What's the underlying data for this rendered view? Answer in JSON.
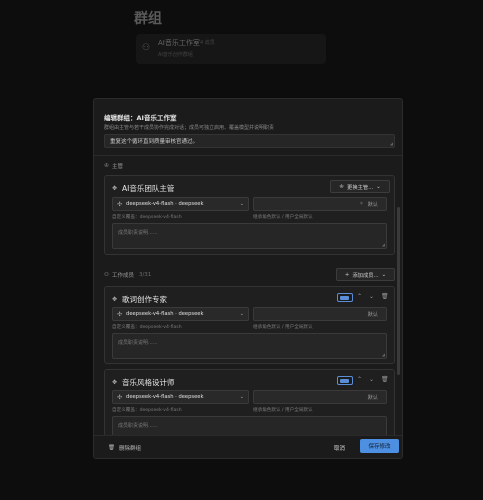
{
  "background": {
    "title": "群组",
    "group_card": {
      "name": "AI音乐工作室",
      "count": "4 成员",
      "desc": "AI音乐创作群组"
    }
  },
  "modal": {
    "title": "编辑群组：AI音乐工作室",
    "desc": "群组由主管与若干成员协作完成对话；成员可独立启用、覆盖模型并说明职责",
    "top_textarea_value": "重复这个循环直到质量审核官通过。",
    "supervisor_section": {
      "label": "主管"
    },
    "supervisor": {
      "name": "AI音乐团队主管",
      "change_button": "更换主管...",
      "model": "deepseek-v4-flash · deepseek",
      "model_hint": "自定义覆盖：deepseek-v4-flash",
      "default_label": "默认",
      "default_hint": "继承角色默认 / 用户全局默认",
      "role_placeholder": "成员职责说明......"
    },
    "members_section": {
      "label": "工作成员",
      "count": "3/31",
      "add_button": "添加成员..."
    },
    "members": [
      {
        "name": "歌词创作专家",
        "model": "deepseek-v4-flash · deepseek",
        "model_hint": "自定义覆盖：deepseek-v4-flash",
        "default_label": "默认",
        "default_hint": "继承角色默认 / 用户全局默认",
        "role_placeholder": "成员职责说明......",
        "enabled": true
      },
      {
        "name": "音乐风格设计师",
        "model": "deepseek-v4-flash · deepseek",
        "model_hint": "自定义覆盖：deepseek-v4-flash",
        "default_label": "默认",
        "default_hint": "继承角色默认 / 用户全局默认",
        "role_placeholder": "成员职责说明......",
        "enabled": true
      }
    ],
    "footer": {
      "delete_label": "删除群组",
      "cancel_label": "取消",
      "save_label": "保存修改"
    }
  },
  "colors": {
    "accent": "#4d8fe0",
    "background": "#0d0d0d",
    "panel": "#1b1b1b"
  }
}
